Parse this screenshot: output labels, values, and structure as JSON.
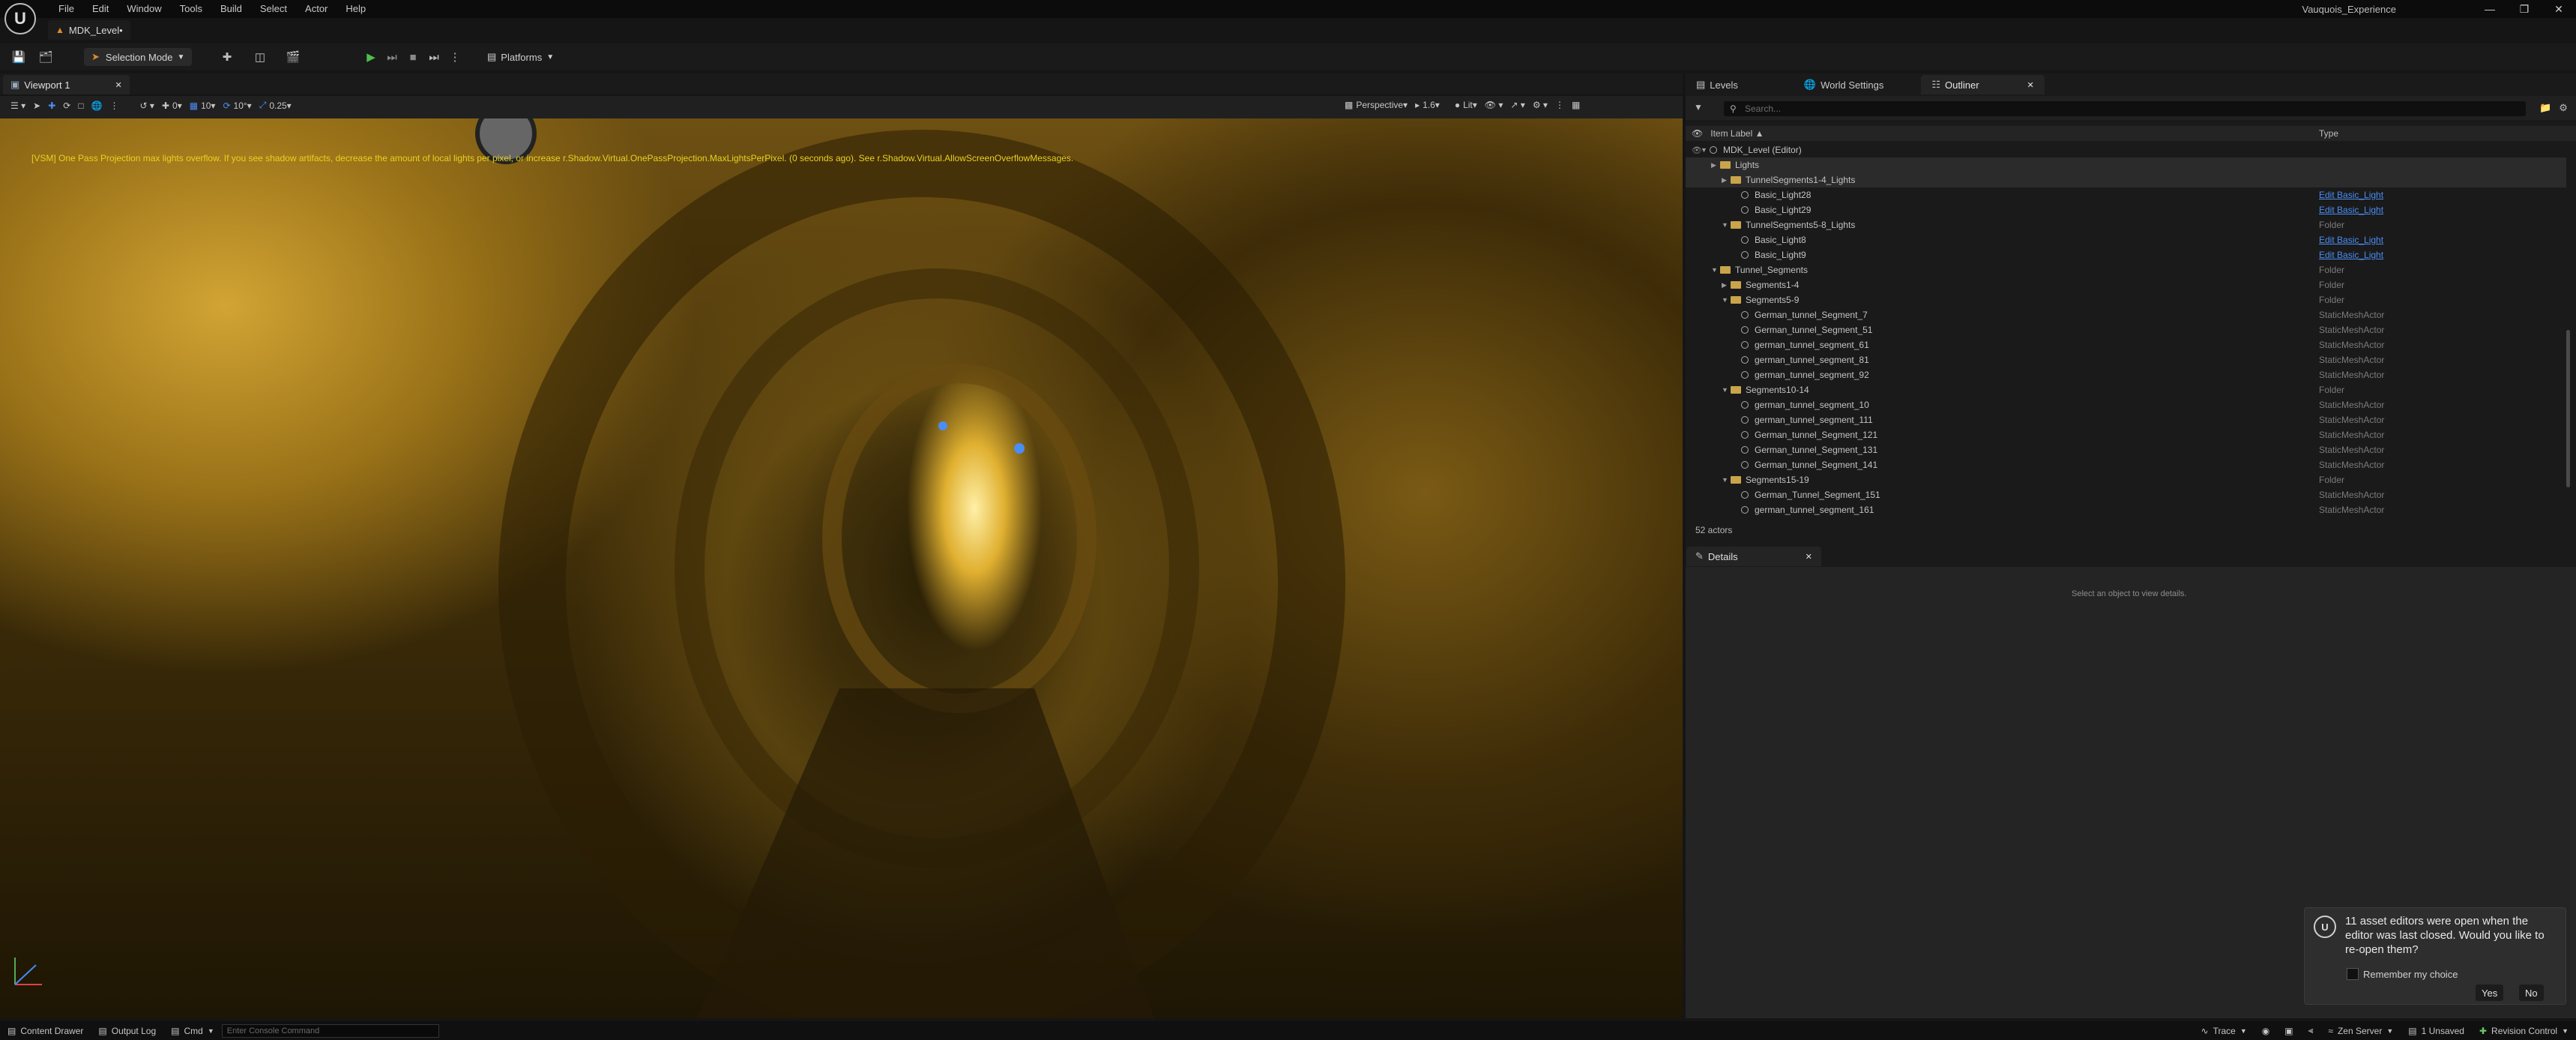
{
  "app": {
    "project_name": "Vauquois_Experience",
    "level_tab": "MDK_Level•"
  },
  "menu": [
    "File",
    "Edit",
    "Window",
    "Tools",
    "Build",
    "Select",
    "Actor",
    "Help"
  ],
  "toolbar": {
    "mode": "Selection Mode",
    "platforms": "Platforms"
  },
  "viewport": {
    "tab": "Viewport 1",
    "snap_translate": "10",
    "snap_rotate": "10°",
    "snap_scale": "0.25",
    "camera_speed_label": "0",
    "perspective": "Perspective",
    "fov": "1.6",
    "lit": "Lit",
    "warning": "[VSM] One Pass Projection max lights overflow. If you see shadow artifacts, decrease the amount of local lights per pixel, or increase r.Shadow.Virtual.OnePassProjection.MaxLightsPerPixel. (0 seconds ago). See r.Shadow.Virtual.AllowScreenOverflowMessages."
  },
  "panels": {
    "tabs": [
      "Levels",
      "World Settings",
      "Outliner"
    ],
    "search_placeholder": "Search...",
    "col_label": "Item Label ▲",
    "col_type": "Type",
    "actor_count": "52 actors",
    "rows": [
      {
        "label": "MDK_Level (Editor)",
        "type": "",
        "icon": "world",
        "depth": 0,
        "expanded": true
      },
      {
        "label": "Lights",
        "type": "",
        "icon": "folder",
        "depth": 1,
        "expanded": false,
        "selected": true
      },
      {
        "label": "TunnelSegments1-4_Lights",
        "type": "",
        "icon": "folder",
        "depth": 2,
        "expanded": false,
        "selected": true
      },
      {
        "label": "Basic_Light28",
        "type": "Edit Basic_Light",
        "icon": "light",
        "depth": 3,
        "link": true
      },
      {
        "label": "Basic_Light29",
        "type": "Edit Basic_Light",
        "icon": "light",
        "depth": 3,
        "link": true
      },
      {
        "label": "TunnelSegments5-8_Lights",
        "type": "Folder",
        "icon": "folder",
        "depth": 2,
        "expanded": true
      },
      {
        "label": "Basic_Light8",
        "type": "Edit Basic_Light",
        "icon": "light",
        "depth": 3,
        "link": true
      },
      {
        "label": "Basic_Light9",
        "type": "Edit Basic_Light",
        "icon": "light",
        "depth": 3,
        "link": true
      },
      {
        "label": "Tunnel_Segments",
        "type": "Folder",
        "icon": "folder",
        "depth": 1,
        "expanded": true
      },
      {
        "label": "Segments1-4",
        "type": "Folder",
        "icon": "folder",
        "depth": 2,
        "expanded": false
      },
      {
        "label": "Segments5-9",
        "type": "Folder",
        "icon": "folder",
        "depth": 2,
        "expanded": true
      },
      {
        "label": "German_tunnel_Segment_7",
        "type": "StaticMeshActor",
        "icon": "mesh",
        "depth": 3
      },
      {
        "label": "German_tunnel_Segment_51",
        "type": "StaticMeshActor",
        "icon": "mesh",
        "depth": 3
      },
      {
        "label": "german_tunnel_segment_61",
        "type": "StaticMeshActor",
        "icon": "mesh",
        "depth": 3
      },
      {
        "label": "german_tunnel_segment_81",
        "type": "StaticMeshActor",
        "icon": "mesh",
        "depth": 3
      },
      {
        "label": "german_tunnel_segment_92",
        "type": "StaticMeshActor",
        "icon": "mesh",
        "depth": 3
      },
      {
        "label": "Segments10-14",
        "type": "Folder",
        "icon": "folder",
        "depth": 2,
        "expanded": true
      },
      {
        "label": "german_tunnel_segment_10",
        "type": "StaticMeshActor",
        "icon": "mesh",
        "depth": 3
      },
      {
        "label": "german_tunnel_segment_111",
        "type": "StaticMeshActor",
        "icon": "mesh",
        "depth": 3
      },
      {
        "label": "German_tunnel_Segment_121",
        "type": "StaticMeshActor",
        "icon": "mesh",
        "depth": 3
      },
      {
        "label": "German_tunnel_Segment_131",
        "type": "StaticMeshActor",
        "icon": "mesh",
        "depth": 3
      },
      {
        "label": "German_tunnel_Segment_141",
        "type": "StaticMeshActor",
        "icon": "mesh",
        "depth": 3
      },
      {
        "label": "Segments15-19",
        "type": "Folder",
        "icon": "folder",
        "depth": 2,
        "expanded": true
      },
      {
        "label": "German_Tunnel_Segment_151",
        "type": "StaticMeshActor",
        "icon": "mesh",
        "depth": 3
      },
      {
        "label": "german_tunnel_segment_161",
        "type": "StaticMeshActor",
        "icon": "mesh",
        "depth": 3
      }
    ],
    "details_tab": "Details",
    "details_hint": "Select an object to view details."
  },
  "notification": {
    "message": "11 asset editors were open when the editor was last closed. Would you like to re-open them?",
    "remember": "Remember my choice",
    "yes": "Yes",
    "no": "No"
  },
  "statusbar": {
    "content_drawer": "Content Drawer",
    "output_log": "Output Log",
    "cmd": "Cmd",
    "console_placeholder": "Enter Console Command",
    "trace": "Trace",
    "zen_server": "Zen Server",
    "unsaved": "1 Unsaved",
    "revision_control": "Revision Control"
  }
}
